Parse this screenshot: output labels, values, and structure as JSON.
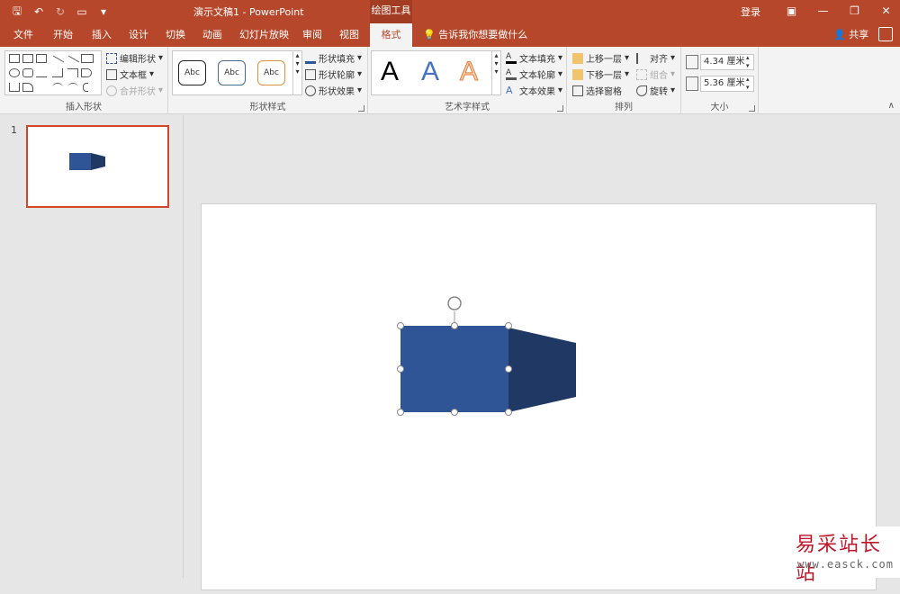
{
  "window": {
    "doc_title": "演示文稿1  -  PowerPoint",
    "context_tab_header": "绘图工具",
    "login": "登录",
    "controls": [
      "—",
      "❐",
      "✕"
    ]
  },
  "qat": {
    "save_icon": "🖫",
    "undo_icon": "↶",
    "redo_icon": "↻",
    "customize_icon": "▾"
  },
  "tabs": [
    {
      "label": "文件"
    },
    {
      "label": "开始"
    },
    {
      "label": "插入"
    },
    {
      "label": "设计"
    },
    {
      "label": "切换"
    },
    {
      "label": "动画"
    },
    {
      "label": "幻灯片放映"
    },
    {
      "label": "审阅"
    },
    {
      "label": "视图"
    },
    {
      "label": "格式"
    }
  ],
  "tellme": "告诉我你想要做什么",
  "share": "共享",
  "ribbon": {
    "insert_shapes": {
      "edit_shape": "编辑形状",
      "text_box": "文本框",
      "merge_shapes": "合并形状",
      "label": "插入形状"
    },
    "shape_styles": {
      "abc": "Abc",
      "fill": "形状填充",
      "outline": "形状轮廓",
      "effects": "形状效果",
      "label": "形状样式"
    },
    "wordart": {
      "letter": "A",
      "text_fill": "文本填充",
      "text_outline": "文本轮廓",
      "text_effects": "文本效果",
      "label": "艺术字样式"
    },
    "arrange": {
      "bring_forward": "上移一层",
      "send_backward": "下移一层",
      "selection_pane": "选择窗格",
      "align": "对齐",
      "group": "组合",
      "rotate": "旋转",
      "label": "排列"
    },
    "size": {
      "height": "4.34 厘米",
      "width": "5.36 厘米",
      "label": "大小"
    }
  },
  "slides_pane": {
    "slide_number": "1"
  },
  "colors": {
    "brand": "#b7472a",
    "shape_front": "#2f5597",
    "shape_side": "#203864",
    "thumb_border": "#d24726"
  },
  "watermark": {
    "main": "易采站长站",
    "url": "www.easck.com"
  }
}
